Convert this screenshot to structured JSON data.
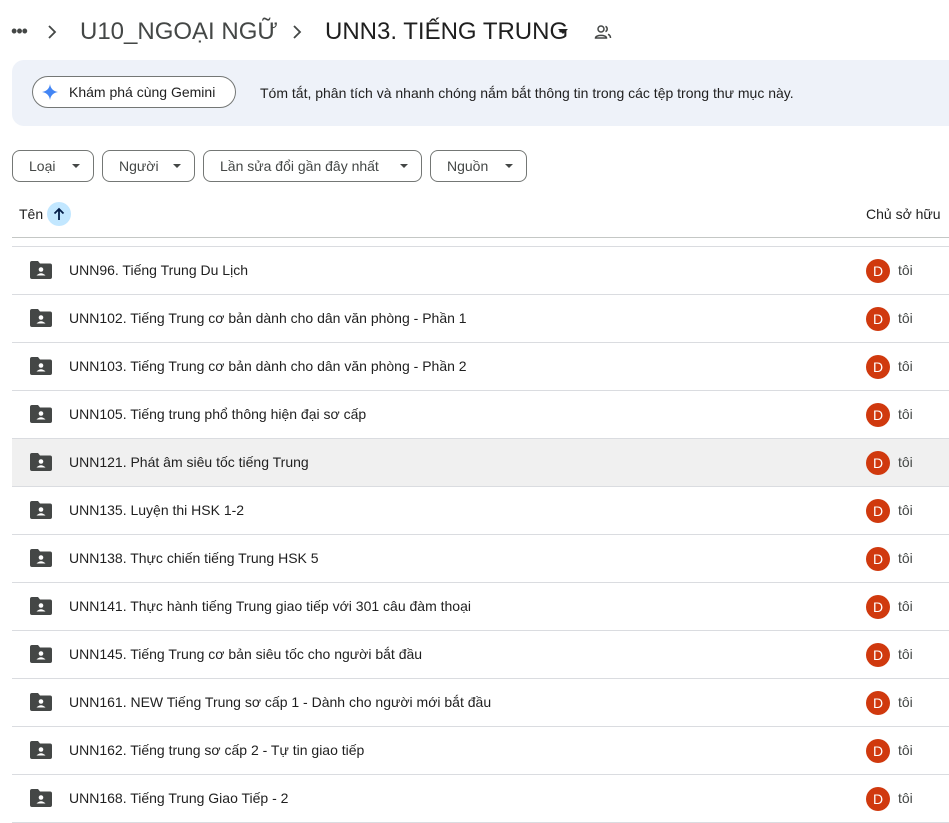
{
  "breadcrumb": {
    "more_glyph": "•••",
    "parent": "U10_NGOẠI NGỮ",
    "current": "UNN3. TIẾNG TRUNG",
    "share_icon": "people-icon"
  },
  "gemini": {
    "button_label": "Khám phá cùng Gemini",
    "description": "Tóm tắt, phân tích và nhanh chóng nắm bắt thông tin trong các tệp trong thư mục này.",
    "accent_color": "#4285f4"
  },
  "filters": [
    "Loại",
    "Người",
    "Lần sửa đổi gần đây nhất",
    "Nguồn"
  ],
  "columns": {
    "name": "Tên",
    "owner": "Chủ sở hữu"
  },
  "rows": [
    {
      "name": "UNN96. Tiếng Trung Du Lịch",
      "avatar": "D",
      "owner": "tôi"
    },
    {
      "name": "UNN102. Tiếng Trung cơ bản dành cho dân văn phòng - Phần 1",
      "avatar": "D",
      "owner": "tôi"
    },
    {
      "name": "UNN103. Tiếng Trung cơ bản dành cho dân văn phòng - Phần 2",
      "avatar": "D",
      "owner": "tôi"
    },
    {
      "name": "UNN105. Tiếng trung phổ thông hiện đại sơ cấp",
      "avatar": "D",
      "owner": "tôi"
    },
    {
      "name": "UNN121. Phát âm siêu tốc tiếng Trung",
      "avatar": "D",
      "owner": "tôi"
    },
    {
      "name": "UNN135. Luyện thi HSK 1-2",
      "avatar": "D",
      "owner": "tôi"
    },
    {
      "name": "UNN138. Thực chiến tiếng Trung HSK 5",
      "avatar": "D",
      "owner": "tôi"
    },
    {
      "name": "UNN141. Thực hành tiếng Trung giao tiếp với 301 câu đàm thoại",
      "avatar": "D",
      "owner": "tôi"
    },
    {
      "name": "UNN145. Tiếng Trung cơ bản siêu tốc cho người bắt đầu",
      "avatar": "D",
      "owner": "tôi"
    },
    {
      "name": "UNN161. NEW Tiếng Trung sơ cấp 1 - Dành cho người mới bắt đầu",
      "avatar": "D",
      "owner": "tôi"
    },
    {
      "name": "UNN162. Tiếng trung sơ cấp 2 - Tự tin giao tiếp",
      "avatar": "D",
      "owner": "tôi"
    },
    {
      "name": "UNN168. Tiếng Trung Giao Tiếp - 2",
      "avatar": "D",
      "owner": "tôi"
    }
  ],
  "colors": {
    "avatar": "#d0390e",
    "sort_active": "#c2e7ff",
    "hover_row": "#f0f0f0"
  }
}
